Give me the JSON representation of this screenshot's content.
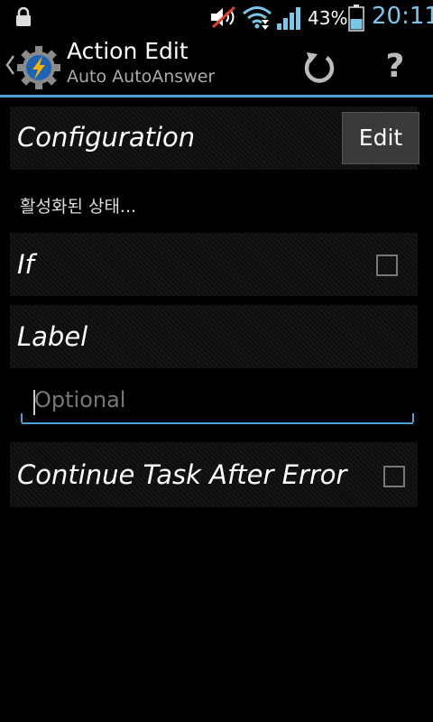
{
  "status_bar": {
    "battery_percent": "43%",
    "time": "20:11",
    "icons": [
      "lock-icon",
      "mute-icon",
      "wifi-icon",
      "signal-icon",
      "battery-icon"
    ]
  },
  "action_bar": {
    "title": "Action Edit",
    "subtitle": "Auto AutoAnswer",
    "help_label": "?",
    "accent_color": "#4aa3d3"
  },
  "configuration": {
    "label": "Configuration",
    "edit_label": "Edit"
  },
  "state_text": "활성화된 상태...",
  "if_row": {
    "label": "If",
    "checked": false
  },
  "label_row": {
    "label": "Label",
    "placeholder": "Optional"
  },
  "continue_row": {
    "label": "Continue Task After Error",
    "checked": false
  }
}
